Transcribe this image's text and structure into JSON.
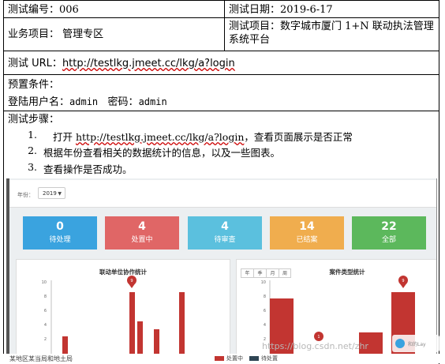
{
  "header": {
    "test_number": "测试编号：006",
    "test_date": "测试日期：2019-6-17",
    "business_item": "业务项目：  管理专区",
    "test_project": "测试项目：数字城市厦门 1+N 联动执法管理系统平台"
  },
  "url": {
    "label": "测试 URL：",
    "value": "http://testlkg.jmeet.cc/lkg/a?login"
  },
  "precondition": {
    "title": "预置条件：",
    "login_prefix": "登陆用户名：",
    "username": "admin",
    "password_prefix": "密码：",
    "password": "admin"
  },
  "steps": {
    "title": "测试步骤：",
    "items": [
      {
        "num": "1.",
        "pre": "打开 ",
        "link": "http://testlkg.jmeet.cc/lkg/a?login",
        "post": "，查看页面展示是否正常"
      },
      {
        "num": "2.",
        "text": "根据年份查看相关的数据统计的信息，以及一些图表。"
      },
      {
        "num": "3.",
        "text": "查看操作是否成功。"
      }
    ]
  },
  "screenshot": {
    "year_label": "年份：",
    "year_value": "2019",
    "cards": [
      {
        "count": "0",
        "label": "待处理",
        "color": "#3aa3df"
      },
      {
        "count": "4",
        "label": "处置中",
        "color": "#e06666"
      },
      {
        "count": "4",
        "label": "待审查",
        "color": "#5bc0de"
      },
      {
        "count": "14",
        "label": "已结案",
        "color": "#f0ad4e"
      },
      {
        "count": "22",
        "label": "全部",
        "color": "#5cb85c"
      }
    ],
    "panel_left_title": "联动单位协作统计",
    "panel_right_title": "案件类型统计",
    "tabs": [
      "年",
      "季",
      "月",
      "周"
    ],
    "bar_color": "#c23531",
    "left_axis": [
      "10",
      "8",
      "6",
      "4",
      "2"
    ],
    "right_axis": [
      "10",
      "8",
      "6",
      "4",
      "2"
    ],
    "left_pin": "9",
    "right_pin": "9",
    "right_pin_small": "1",
    "bottom_left_text": "某地区某当局和地土局",
    "bottom_legend": [
      "处置中",
      "待处置"
    ]
  },
  "watermark": "https://blog.csdn.net/zhr",
  "float_label": "和的Lay"
}
